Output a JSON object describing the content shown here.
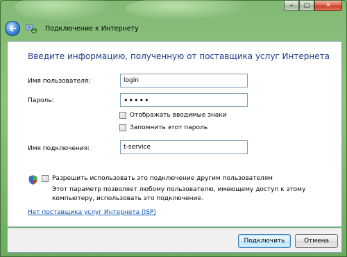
{
  "window": {
    "title": "Подключение к Интернету"
  },
  "colors": {
    "heading": "#1e3e8c",
    "link": "#0a4fb3",
    "close_button": "#c33d22"
  },
  "icons": {
    "back": "back-arrow-icon",
    "network": "network-connection-icon",
    "shield": "security-shield-icon"
  },
  "form": {
    "heading": "Введите информацию, полученную от поставщика услуг Интернета",
    "username_label": "Имя пользователя:",
    "username_value": "login",
    "password_label": "Пароль:",
    "password_value": "•••••",
    "show_chars_label": "Отображать вводимые знаки",
    "show_chars_checked": false,
    "remember_label": "Запомнить этот пароль",
    "remember_checked": false,
    "connection_name_label": "Имя подключения:",
    "connection_name_value": "t-service",
    "allow_others_label": "Разрешить использовать это подключение другим пользователям",
    "allow_others_checked": false,
    "allow_others_desc": "Этот параметр позволяет любому пользователю, имеющему доступ к этому компьютеру, использовать это подключение.",
    "no_isp_link": "Нет поставщика услуг Интернета (ISP)"
  },
  "buttons": {
    "connect": "Подключить",
    "cancel": "Отмена",
    "minimize": "–",
    "maximize": "□",
    "close": "✕"
  }
}
